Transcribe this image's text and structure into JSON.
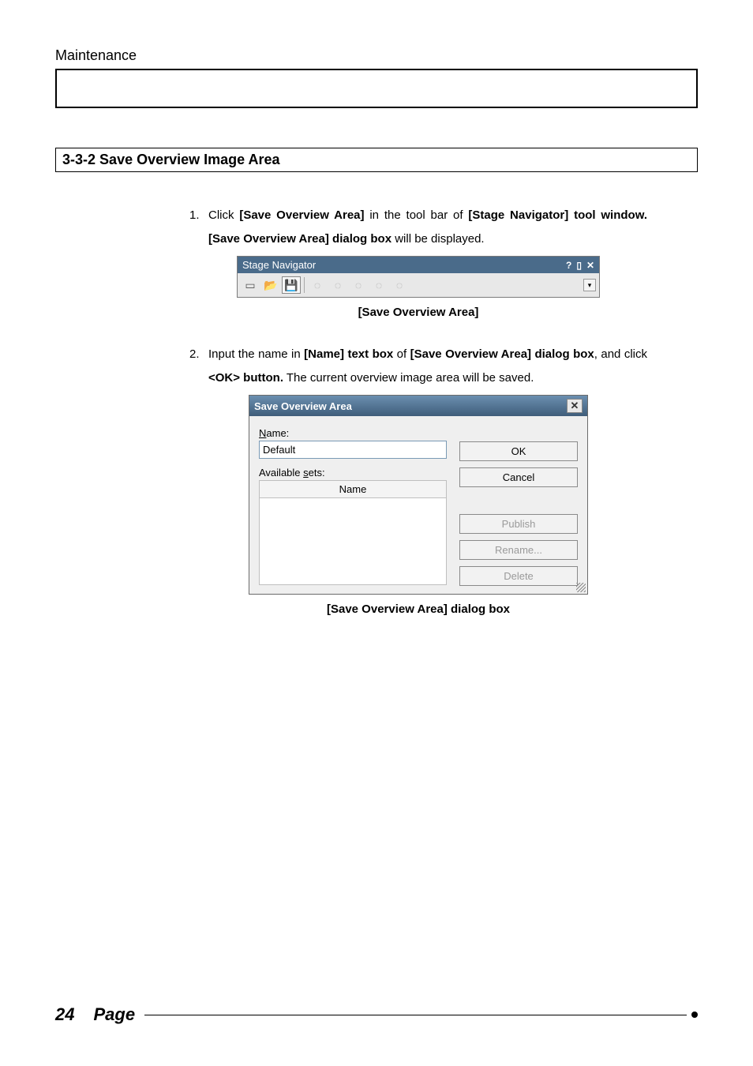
{
  "header": {
    "breadcrumb": "Maintenance"
  },
  "section": {
    "number": "3-3-2",
    "title": "Save Overview Image Area"
  },
  "steps": [
    {
      "num": "1.",
      "parts": {
        "p1": "Click ",
        "b1": "[Save Overview Area]",
        "p2": " in the tool bar of ",
        "b2": "[Stage Navigator] tool window.",
        "b3": " [Save Overview Area] dialog box",
        "p3": " will be displayed."
      }
    },
    {
      "num": "2.",
      "parts": {
        "p1": "Input the name in ",
        "b1": "[Name] text box",
        "p2": " of ",
        "b2": "[Save Overview Area] dialog box",
        "p3": ", and click ",
        "b3": "<OK> button.",
        "p4": " The current overview image area will be saved."
      }
    }
  ],
  "captions": {
    "toolbar": "[Save Overview Area]",
    "dialog": "[Save Overview Area] dialog box"
  },
  "toolwindow": {
    "title": "Stage Navigator",
    "controls": {
      "help": "?",
      "pin": "▯",
      "close": "✕"
    },
    "icons": {
      "new": "▭",
      "open": "📂",
      "save": "💾",
      "g1": "◌",
      "g2": "◌",
      "g3": "◌",
      "g4": "◌",
      "g5": "◌",
      "drop": "▾"
    }
  },
  "dialog": {
    "title": "Save Overview Area",
    "close": "✕",
    "labels": {
      "name_u": "N",
      "name_rest": "ame:",
      "avail_pre": "Available ",
      "avail_u": "s",
      "avail_rest": "ets:",
      "col_name": "Name"
    },
    "fields": {
      "name_value": "Default"
    },
    "buttons": {
      "ok": "OK",
      "cancel": "Cancel",
      "publish_u": "P",
      "publish_rest": "ublish",
      "rename_u": "R",
      "rename_rest": "ename...",
      "delete_u": "D",
      "delete_rest": "elete"
    }
  },
  "footer": {
    "page_number": "24",
    "page_label": "Page"
  }
}
